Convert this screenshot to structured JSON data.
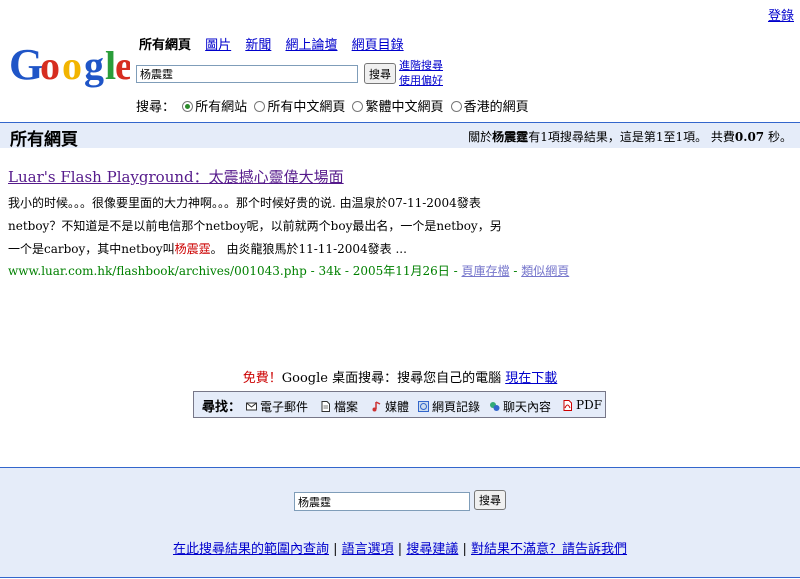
{
  "header": {
    "sign_in": "登錄",
    "logo_text": "Google"
  },
  "tabs": [
    {
      "label": "所有網頁",
      "current": true
    },
    {
      "label": "圖片"
    },
    {
      "label": "新聞"
    },
    {
      "label": "網上論壇"
    },
    {
      "label": "網頁目錄"
    }
  ],
  "search": {
    "query": "杨震霆",
    "button": "搜尋",
    "advanced": "進階搜尋",
    "preferences": "使用偏好"
  },
  "scope": {
    "label": "搜尋：",
    "options": [
      "所有網站",
      "所有中文網頁",
      "繁體中文網頁",
      "香港的網頁"
    ],
    "selected": 0
  },
  "result_bar": {
    "title": "所有網頁",
    "stats_prefix": "關於",
    "stats_query": "杨震霆",
    "stats_mid": "有1項搜尋結果，這是第1至1項。 共費",
    "stats_time": "0.07",
    "stats_suffix": "秒。"
  },
  "result": {
    "title_a": "Luar's Flash Playground：",
    "title_b": "太震撼心靈偉大場面",
    "line1": "我小的时候。。。很像要里面的大力神啊。。。那个时候好贵的说. 由温泉於07-11-2004發表",
    "line2": "netboy？不知道是不是以前电信那个netboy呢，以前就两个boy最出名，一个是netboy，另",
    "line3_a": "一个是carboy，其中netboy叫",
    "line3_hl": "杨震霆",
    "line3_b": "。 由炎龍狼馬於11-11-2004發表 ...",
    "url": "www.luar.com.hk/flashbook/archives/001043.php - 34k - 2005年11月26日 - ",
    "cached": "頁庫存檔",
    "similar": "類似網頁"
  },
  "promo": {
    "free": "免費！",
    "text": "Google 桌面搜尋：搜尋您自己的電腦 ",
    "download": "現在下載",
    "find_label": "尋找：",
    "items": [
      {
        "label": "電子郵件",
        "icon": "envelope-icon"
      },
      {
        "label": "檔案",
        "icon": "document-icon"
      },
      {
        "label": "媒體",
        "icon": "music-note-icon"
      },
      {
        "label": "網頁記錄",
        "icon": "web-history-icon"
      },
      {
        "label": "聊天內容",
        "icon": "chat-icon"
      },
      {
        "label": "PDF",
        "icon": "pdf-icon"
      }
    ]
  },
  "footer": {
    "query": "杨震霆",
    "button": "搜尋",
    "links": [
      "在此搜尋結果的範圍內查詢",
      "語言選項",
      "搜尋建議",
      "對結果不滿意？請告訴我們"
    ]
  },
  "colors": {
    "link": "#0000cc",
    "visited": "#551a8b",
    "url": "#008000",
    "bar": "#e5ecf9",
    "bar_line": "#3366cc",
    "highlight": "#cc0000"
  }
}
